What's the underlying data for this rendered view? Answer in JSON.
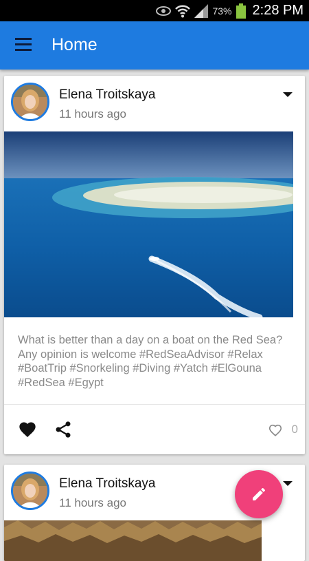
{
  "status_bar": {
    "battery_percent": "73%",
    "time": "2:28 PM"
  },
  "app_bar": {
    "title": "Home",
    "menu_icon": "hamburger-icon"
  },
  "posts": [
    {
      "author": "Elena Troitskaya",
      "time": "11 hours ago",
      "text": "What is better than a day on a boat on the Red Sea? Any opinion is welcome #RedSeaAdvisor #Relax #BoatTrip #Snorkeling #Diving #Yatch #ElGouna #RedSea #Egypt",
      "likes": "0"
    },
    {
      "author": "Elena Troitskaya",
      "time": "11 hours ago"
    }
  ],
  "fab": {
    "icon": "pencil-icon"
  },
  "colors": {
    "primary": "#1e7be0",
    "accent": "#f0407a"
  }
}
